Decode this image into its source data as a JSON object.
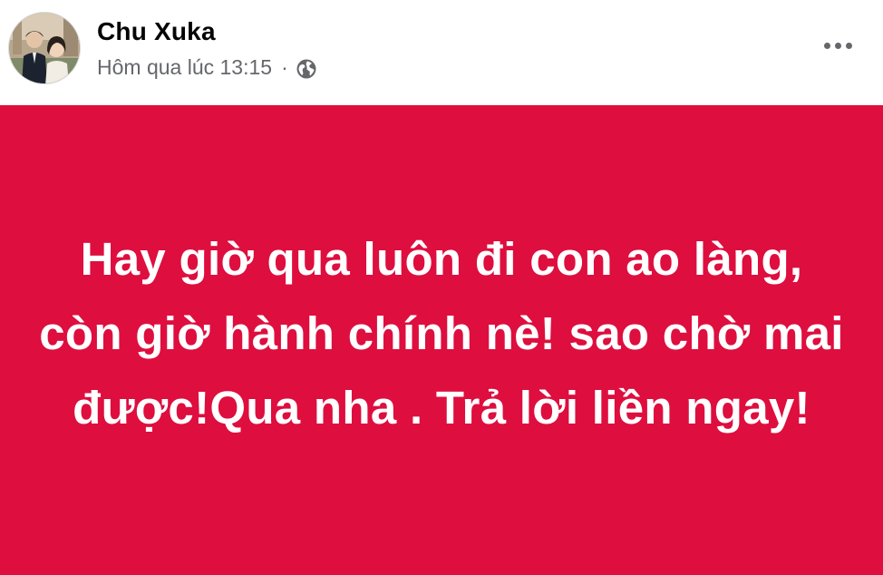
{
  "post": {
    "author": "Chu Xuka",
    "timestamp": "Hôm qua lúc 13:15",
    "separator": "·",
    "privacy_icon": "globe-icon",
    "more_icon": "more-options-icon",
    "status_text": "Hay giờ qua luôn đi con ao làng, còn giờ hành chính nè! sao chờ mai được!Qua nha . Trả lời liền ngay!"
  },
  "colors": {
    "card_background": "#de0e3f",
    "text_on_card": "#ffffff",
    "author_text": "#050505",
    "secondary_text": "#65676b"
  }
}
